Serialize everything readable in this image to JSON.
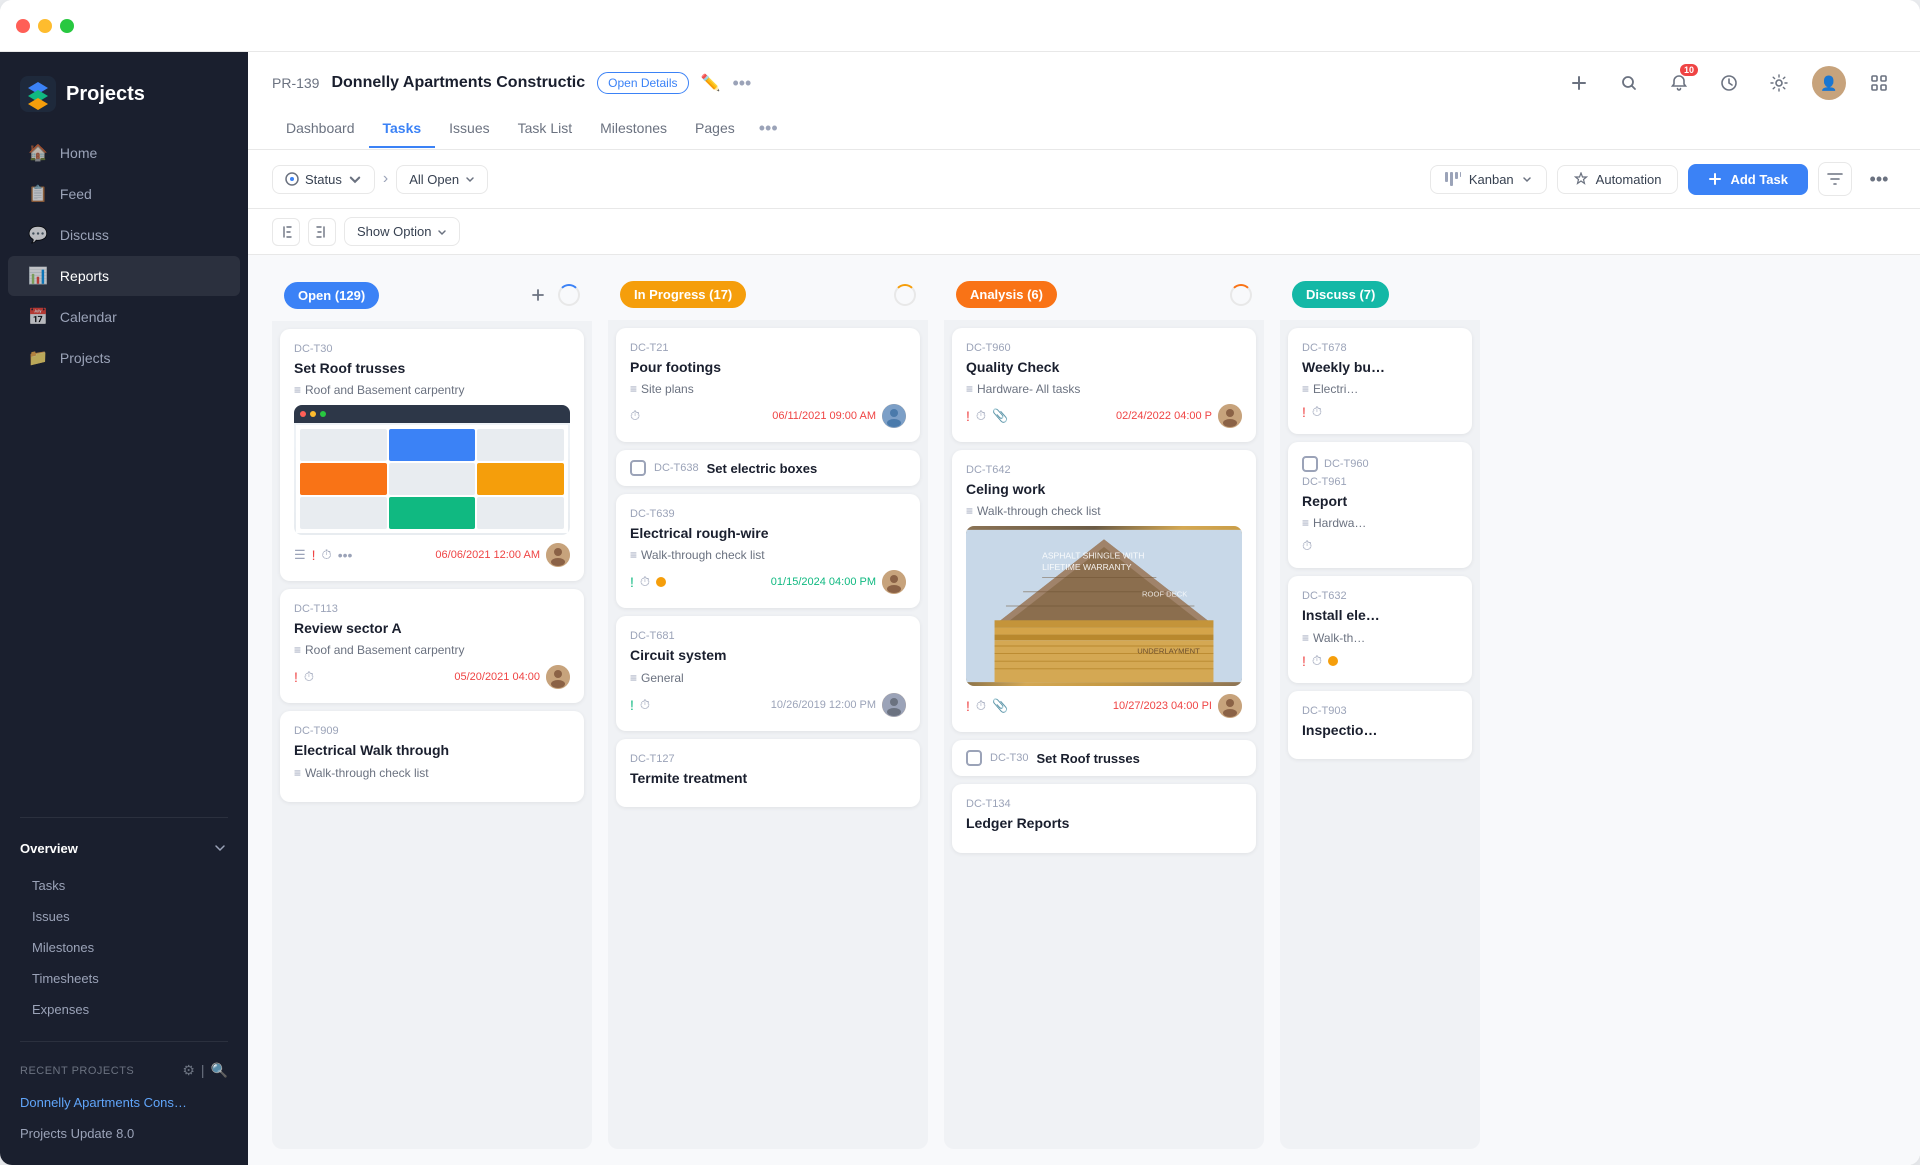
{
  "window": {
    "title": "Projects"
  },
  "trafficLights": [
    "red",
    "yellow",
    "green"
  ],
  "sidebar": {
    "logo": "Projects",
    "nav": [
      {
        "id": "home",
        "icon": "🏠",
        "label": "Home"
      },
      {
        "id": "feed",
        "icon": "📋",
        "label": "Feed"
      },
      {
        "id": "discuss",
        "icon": "💬",
        "label": "Discuss"
      },
      {
        "id": "reports",
        "icon": "📊",
        "label": "Reports"
      },
      {
        "id": "calendar",
        "icon": "📅",
        "label": "Calendar"
      },
      {
        "id": "projects",
        "icon": "📁",
        "label": "Projects"
      }
    ],
    "overview": "Overview",
    "overviewItems": [
      "Tasks",
      "Issues",
      "Milestones",
      "Timesheets",
      "Expenses"
    ],
    "recentLabel": "Recent Projects",
    "recentProjects": [
      {
        "id": "donnelly",
        "label": "Donnelly Apartments Cons…",
        "active": true
      },
      {
        "id": "projects-update",
        "label": "Projects Update 8.0",
        "active": false
      }
    ]
  },
  "header": {
    "projectId": "PR-139",
    "projectName": "Donnelly Apartments Constructic",
    "openDetailsBtn": "Open Details",
    "tabs": [
      "Dashboard",
      "Tasks",
      "Issues",
      "Task List",
      "Milestones",
      "Pages"
    ],
    "activeTab": "Tasks",
    "notificationCount": "10"
  },
  "toolbar": {
    "statusBtn": "Status",
    "allOpenBtn": "All Open",
    "kanbanBtn": "Kanban",
    "automationBtn": "Automation",
    "addTaskBtn": "Add Task"
  },
  "kanbanBar": {
    "showOptionBtn": "Show Option"
  },
  "columns": [
    {
      "id": "open",
      "label": "Open (129)",
      "colorClass": "open",
      "cards": [
        {
          "id": "DC-T30",
          "title": "Set Roof trusses",
          "sub": "Roof and Basement carpentry",
          "hasScreenshot": true,
          "hasImage": false,
          "footer": {
            "priority": "high",
            "hasClock": true,
            "hasDots": true,
            "date": "06/06/2021 12:00 AM",
            "dateColor": "red",
            "hasAvatar": true
          }
        },
        {
          "id": "DC-T113",
          "title": "Review sector A",
          "sub": "Roof and Basement carpentry",
          "hasScreenshot": false,
          "hasImage": false,
          "footer": {
            "priority": "high",
            "hasClock": true,
            "date": "05/20/2021 04:00",
            "dateColor": "red",
            "hasAvatar": true
          }
        },
        {
          "id": "DC-T909",
          "title": "Electrical Walk through",
          "sub": "Walk-through check list",
          "hasScreenshot": false,
          "hasImage": false,
          "footer": {}
        }
      ]
    },
    {
      "id": "inprogress",
      "label": "In Progress (17)",
      "colorClass": "inprogress",
      "cards": [
        {
          "id": "DC-T21",
          "title": "Pour footings",
          "sub": "Site plans",
          "hasScreenshot": false,
          "footer": {
            "hasClock": true,
            "date": "06/11/2021 09:00 AM",
            "dateColor": "red",
            "hasAvatar": true
          }
        },
        {
          "groupHeader": true,
          "groupId": "DC-T638",
          "groupLabel": "Set electric boxes",
          "id": "DC-T639",
          "title": "Electrical rough-wire",
          "sub": "Walk-through check list",
          "hasScreenshot": false,
          "footer": {
            "priority": "green",
            "hasClock": true,
            "hasYellowDot": true,
            "date": "01/15/2024 04:00 PM",
            "dateColor": "green",
            "hasAvatar": true
          }
        },
        {
          "id": "DC-T681",
          "title": "Circuit system",
          "sub": "General",
          "hasScreenshot": false,
          "footer": {
            "priority": "green",
            "hasClock": true,
            "date": "10/26/2019 12:00 PM",
            "dateColor": "gray",
            "hasAvatar": true
          }
        },
        {
          "id": "DC-T127",
          "title": "Termite treatment",
          "sub": "",
          "hasScreenshot": false,
          "footer": {}
        }
      ]
    },
    {
      "id": "analysis",
      "label": "Analysis (6)",
      "colorClass": "analysis",
      "cards": [
        {
          "id": "DC-T960",
          "title": "Quality Check",
          "sub": "Hardware- All tasks",
          "hasScreenshot": false,
          "footer": {
            "priority": "high",
            "hasClock": true,
            "hasPaperclip": true,
            "date": "02/24/2022 04:00 P",
            "dateColor": "red",
            "hasAvatar": true
          }
        },
        {
          "id": "DC-T642",
          "title": "Celing work",
          "sub": "Walk-through check list",
          "hasRoofImage": true,
          "footer": {
            "priority": "high",
            "hasClock": true,
            "hasPaperclip": true,
            "date": "10/27/2023 04:00 PI",
            "dateColor": "red",
            "hasAvatar": true
          }
        },
        {
          "groupHeader2": true,
          "groupId2": "DC-T30",
          "groupLabel2": "Set Roof trusses",
          "id": "DC-T134",
          "title": "Ledger Reports",
          "sub": "",
          "hasScreenshot": false,
          "footer": {}
        }
      ]
    },
    {
      "id": "discuss",
      "label": "Discuss (7)",
      "colorClass": "discuss",
      "partialCards": [
        {
          "id": "DC-T678",
          "title": "Weekly bu…",
          "sub": "Electri…"
        },
        {
          "groupId": "DC-T960",
          "title": "Report",
          "sub": "Hardwa…",
          "footer": {
            "hasClock": true
          }
        },
        {
          "id": "DC-T632",
          "title": "Install ele…",
          "sub": "Walk-th…",
          "footer": {
            "priority": "high",
            "hasClock": true,
            "hasYellowDot": true
          }
        },
        {
          "id": "DC-T903",
          "title": "Inspectio…",
          "sub": ""
        }
      ]
    }
  ]
}
